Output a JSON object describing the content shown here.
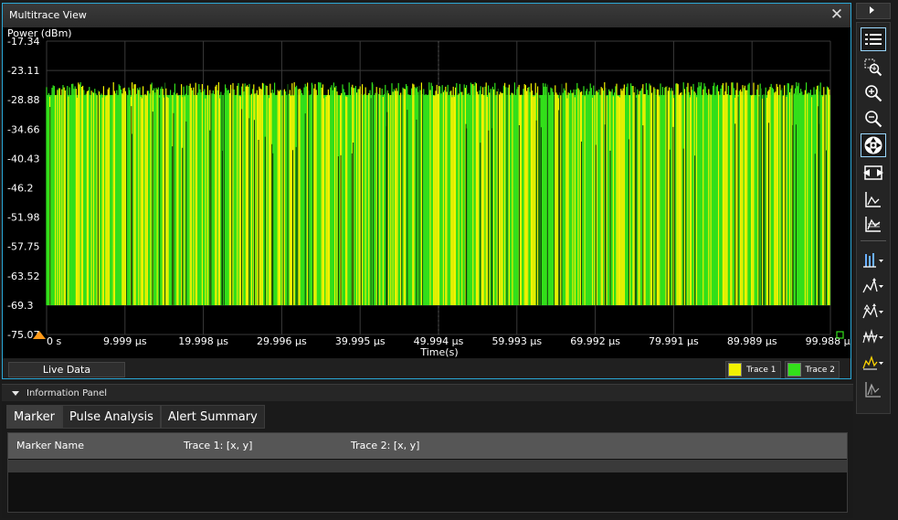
{
  "window": {
    "title": "Multitrace View"
  },
  "chart_data": {
    "type": "line",
    "ylabel": "Power (dBm)",
    "xlabel": "Time(s)",
    "y_ticks": [
      "-17.34",
      "-23.11",
      "-28.88",
      "-34.66",
      "-40.43",
      "-46.2",
      "-51.98",
      "-57.75",
      "-63.52",
      "-69.3",
      "-75.07"
    ],
    "ylim": [
      -75.07,
      -17.34
    ],
    "x_ticks": [
      "0 s",
      "9.999 µs",
      "19.998 µs",
      "29.996 µs",
      "39.995 µs",
      "49.994 µs",
      "59.993 µs",
      "69.992 µs",
      "79.991 µs",
      "89.989 µs",
      "99.988 µs"
    ],
    "xlim": [
      0,
      99.988
    ],
    "x_unit": "µs",
    "noise_floor_dbm": -69.3,
    "peak_level_dbm": -26.5,
    "series": [
      {
        "name": "Trace 1",
        "color": "#f2f200"
      },
      {
        "name": "Trace 2",
        "color": "#33e01a"
      }
    ],
    "grid": true
  },
  "bottom_bar": {
    "live_data_label": "Live Data"
  },
  "legend": [
    {
      "label": "Trace 1",
      "color": "#f2f200"
    },
    {
      "label": "Trace 2",
      "color": "#33e01a"
    }
  ],
  "toolbar": {
    "icons": [
      "list-icon",
      "zoom-region-icon",
      "zoom-in-icon",
      "zoom-out-icon",
      "pan-icon",
      "fit-horizontal-icon",
      "trace-line-icon",
      "trace-area-icon",
      "bar-measure-icon",
      "marker-icon",
      "delta-marker-icon",
      "threshold-icon",
      "peak-marker-icon",
      "pulse-icon"
    ]
  },
  "info_panel": {
    "title": "Information Panel",
    "tabs": [
      {
        "label": "Marker",
        "active": true
      },
      {
        "label": "Pulse Analysis",
        "active": false
      },
      {
        "label": "Alert Summary",
        "active": false
      }
    ],
    "table": {
      "columns": [
        "Marker Name",
        "Trace 1: [x, y]",
        "Trace 2: [x, y]"
      ],
      "rows": []
    }
  }
}
